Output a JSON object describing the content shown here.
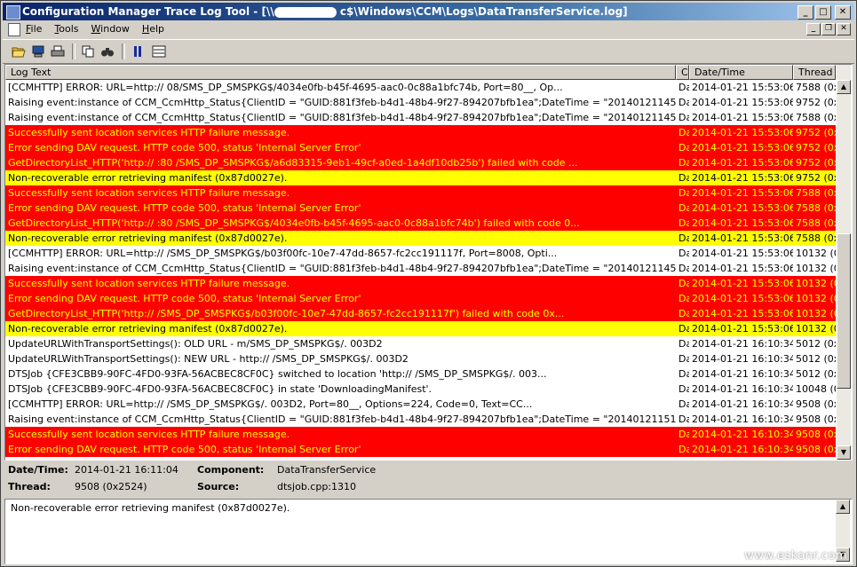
{
  "window": {
    "title_prefix": "Configuration Manager Trace Log Tool - [\\\\",
    "title_suffix": "c$\\Windows\\CCM\\Logs\\DataTransferService.log]"
  },
  "menu": [
    "File",
    "Tools",
    "Window",
    "Help"
  ],
  "columns": {
    "text": "Log Text",
    "component": "C",
    "date": "Date/Time",
    "thread": "Thread"
  },
  "rows": [
    {
      "style": "white",
      "text": "[CCMHTTP] ERROR: URL=http://                                          08/SMS_DP_SMSPKG$/4034e0fb-b45f-4695-aac0-0c88a1bfc74b, Port=80__, Op...",
      "comp": "Da",
      "date": "2014-01-21 15:53:06",
      "thread": "7588 (0x"
    },
    {
      "style": "white",
      "text": "Raising event:instance of CCM_CcmHttp_Status{ClientID = \"GUID:881f3feb-b4d1-48b4-9f27-894207bfb1ea\";DateTime = \"20140121145306.129000+0...",
      "comp": "Da",
      "date": "2014-01-21 15:53:06",
      "thread": "9752 (0x"
    },
    {
      "style": "white",
      "text": "Raising event:instance of CCM_CcmHttp_Status{ClientID = \"GUID:881f3feb-b4d1-48b4-9f27-894207bfb1ea\";DateTime = \"20140121145306.131000+0...",
      "comp": "Da",
      "date": "2014-01-21 15:53:06",
      "thread": "7588 (0x"
    },
    {
      "style": "red",
      "text": "Successfully sent location services HTTP failure message.",
      "comp": "Da",
      "date": "2014-01-21 15:53:06",
      "thread": "9752 (0x"
    },
    {
      "style": "red",
      "text": "Error sending DAV request. HTTP code 500, status 'Internal Server Error'",
      "comp": "Da",
      "date": "2014-01-21 15:53:06",
      "thread": "9752 (0x"
    },
    {
      "style": "red",
      "text": "GetDirectoryList_HTTP('http://                                           :80    /SMS_DP_SMSPKG$/a6d83315-9eb1-49cf-a0ed-1a4df10db25b') failed with code ...",
      "comp": "Da",
      "date": "2014-01-21 15:53:06",
      "thread": "9752 (0x"
    },
    {
      "style": "yellow",
      "text": "Non-recoverable error retrieving manifest (0x87d0027e).",
      "comp": "Da",
      "date": "2014-01-21 15:53:06",
      "thread": "9752 (0x"
    },
    {
      "style": "red",
      "text": "Successfully sent location services HTTP failure message.",
      "comp": "Da",
      "date": "2014-01-21 15:53:06",
      "thread": "7588 (0x"
    },
    {
      "style": "red",
      "text": "Error sending DAV request. HTTP code 500, status 'Internal Server Error'",
      "comp": "Da",
      "date": "2014-01-21 15:53:06",
      "thread": "7588 (0x"
    },
    {
      "style": "red",
      "text": "GetDirectoryList_HTTP('http://                                           :80    /SMS_DP_SMSPKG$/4034e0fb-b45f-4695-aac0-0c88a1bfc74b') failed with code 0...",
      "comp": "Da",
      "date": "2014-01-21 15:53:06",
      "thread": "7588 (0x"
    },
    {
      "style": "yellow",
      "text": "Non-recoverable error retrieving manifest (0x87d0027e).",
      "comp": "Da",
      "date": "2014-01-21 15:53:06",
      "thread": "7588 (0x"
    },
    {
      "style": "white",
      "text": "[CCMHTTP] ERROR: URL=http://                                  /SMS_DP_SMSPKG$/b03f00fc-10e7-47dd-8657-fc2cc191117f, Port=8008, Opti...",
      "comp": "Da",
      "date": "2014-01-21 15:53:06",
      "thread": "10132 (0"
    },
    {
      "style": "white",
      "text": "Raising event:instance of CCM_CcmHttp_Status{ClientID = \"GUID:881f3feb-b4d1-48b4-9f27-894207bfb1ea\";DateTime = \"20140121145306.141000+0...",
      "comp": "Da",
      "date": "2014-01-21 15:53:06",
      "thread": "10132 (0"
    },
    {
      "style": "red",
      "text": "Successfully sent location services HTTP failure message.",
      "comp": "Da",
      "date": "2014-01-21 15:53:06",
      "thread": "10132 (0"
    },
    {
      "style": "red",
      "text": "Error sending DAV request. HTTP code 500, status 'Internal Server Error'",
      "comp": "Da",
      "date": "2014-01-21 15:53:06",
      "thread": "10132 (0"
    },
    {
      "style": "red",
      "text": "GetDirectoryList_HTTP('http://                                                  /SMS_DP_SMSPKG$/b03f00fc-10e7-47dd-8657-fc2cc191117f') failed with code 0x...",
      "comp": "Da",
      "date": "2014-01-21 15:53:06",
      "thread": "10132 (0"
    },
    {
      "style": "yellow",
      "text": "Non-recoverable error retrieving manifest (0x87d0027e).",
      "comp": "Da",
      "date": "2014-01-21 15:53:06",
      "thread": "10132 (0"
    },
    {
      "style": "white",
      "text": "UpdateURLWithTransportSettings(): OLD URL -                                     m/SMS_DP_SMSPKG$/.      003D2",
      "comp": "Da",
      "date": "2014-01-21 16:10:34",
      "thread": "5012 (0x"
    },
    {
      "style": "white",
      "text": "UpdateURLWithTransportSettings(): NEW URL - http://                               /SMS_DP_SMSPKG$/.     003D2",
      "comp": "Da",
      "date": "2014-01-21 16:10:34",
      "thread": "5012 (0x"
    },
    {
      "style": "white",
      "text": "DTSJob {CFE3CBB9-90FC-4FD0-93FA-56ACBEC8CF0C} switched to location 'http://                                  /SMS_DP_SMSPKG$/.      003...",
      "comp": "Da",
      "date": "2014-01-21 16:10:34",
      "thread": "5012 (0x"
    },
    {
      "style": "white",
      "text": "DTSJob {CFE3CBB9-90FC-4FD0-93FA-56ACBEC8CF0C} in state 'DownloadingManifest'.",
      "comp": "Da",
      "date": "2014-01-21 16:10:34",
      "thread": "10048 (0"
    },
    {
      "style": "white",
      "text": "[CCMHTTP] ERROR: URL=http://                                /SMS_DP_SMSPKG$/.    003D2, Port=80__, Options=224, Code=0, Text=CC...",
      "comp": "Da",
      "date": "2014-01-21 16:10:34",
      "thread": "9508 (0x"
    },
    {
      "style": "white",
      "text": "Raising event:instance of CCM_CcmHttp_Status{ClientID = \"GUID:881f3feb-b4d1-48b4-9f27-894207bfb1ea\";DateTime = \"20140121151034.616000+0...",
      "comp": "Da",
      "date": "2014-01-21 16:10:34",
      "thread": "9508 (0x"
    },
    {
      "style": "red",
      "text": "Successfully sent location services HTTP failure message.",
      "comp": "Da",
      "date": "2014-01-21 16:10:34",
      "thread": "9508 (0x"
    },
    {
      "style": "red",
      "text": "Error sending DAV request. HTTP code 500, status 'Internal Server Error'",
      "comp": "Da",
      "date": "2014-01-21 16:10:34",
      "thread": "9508 (0x"
    }
  ],
  "details": {
    "datetime_label": "Date/Time:",
    "datetime_value": "2014-01-21 16:11:04",
    "component_label": "Component:",
    "component_value": "DataTransferService",
    "thread_label": "Thread:",
    "thread_value": "9508 (0x2524)",
    "source_label": "Source:",
    "source_value": "dtsjob.cpp:1310"
  },
  "message": "Non-recoverable error retrieving manifest (0x87d0027e).",
  "watermark": "www.eskonr.com",
  "colors": {
    "error_bg": "#ff0000",
    "error_fg": "#ffff00",
    "warning_bg": "#ffff00",
    "title_bar": "#0a246a"
  },
  "icons": [
    "open-icon",
    "computer-icon",
    "print-icon",
    "copy-icon",
    "find-icon",
    "pause-icon",
    "filter-icon"
  ]
}
